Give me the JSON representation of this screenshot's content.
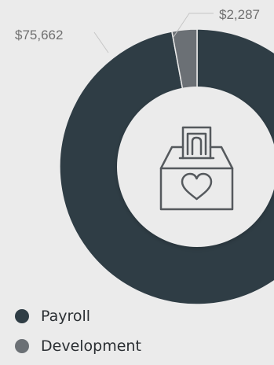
{
  "chart_data": {
    "type": "pie",
    "style": "donut",
    "categories": [
      "Payroll",
      "Development"
    ],
    "values": [
      75662,
      2287
    ],
    "data_labels": [
      "$75,662",
      "$2,287"
    ],
    "colors": [
      "#2f3d45",
      "#6b7075"
    ],
    "legend": "bottom-left"
  },
  "center_icon": "donation-box-heart-icon",
  "colors": {
    "background": "#ebebeb",
    "inner_circle": "#ebebeb",
    "icon_stroke": "#55595d",
    "label_text": "#707070",
    "leader_line": "#c6c6c6"
  }
}
